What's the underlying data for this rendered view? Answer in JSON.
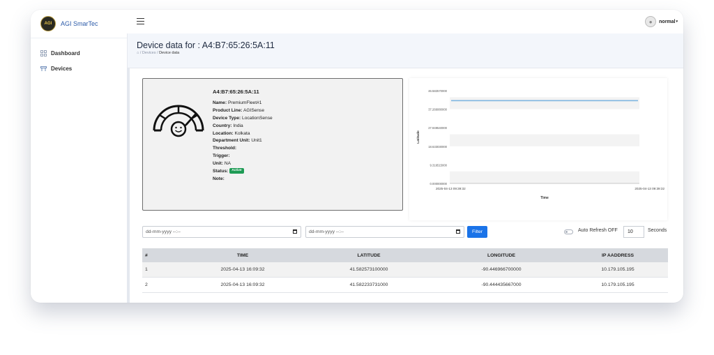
{
  "brand": {
    "name": "AGI SmarTec",
    "logo_text": "AGI"
  },
  "sidebar": {
    "items": [
      {
        "label": "Dashboard",
        "icon": "grid-icon"
      },
      {
        "label": "Devices",
        "icon": "devices-icon"
      }
    ]
  },
  "topbar": {
    "user": "normal"
  },
  "page": {
    "title": "Device data for : A4:B7:65:26:5A:11",
    "breadcrumb": {
      "home": "⌂",
      "sep1": "/",
      "devices": "Devices",
      "sep2": "/",
      "current": "Device data"
    }
  },
  "device": {
    "mac": "A4:B7:65:26:5A:11",
    "fields": [
      {
        "label": "Name:",
        "value": "PremiumFleet#1"
      },
      {
        "label": "Product Line:",
        "value": "AGISense"
      },
      {
        "label": "Device Type:",
        "value": "LocationSense"
      },
      {
        "label": "Country:",
        "value": "India"
      },
      {
        "label": "Location:",
        "value": "Kolkata"
      },
      {
        "label": "Department Unit:",
        "value": "Unit1"
      },
      {
        "label": "Threshold:",
        "value": ""
      },
      {
        "label": "Trigger:",
        "value": ""
      },
      {
        "label": "Unit:",
        "value": "NA"
      }
    ],
    "status_label": "Status:",
    "status": "Active",
    "note_label": "Note:",
    "note": ""
  },
  "chart_data": {
    "type": "line",
    "x": [
      "2025-04-13 09:39:32",
      "2025-04-13 09:39:32"
    ],
    "series": [
      {
        "values": [
          41.582573,
          41.582234
        ],
        "color": "#7fb6e0"
      }
    ],
    "xlabel": "Time",
    "ylabel": "Latitude",
    "yticks": [
      "46.582570000",
      "37.266080000",
      "27.949540000",
      "18.633030000",
      "9.316515000",
      "0.000000000"
    ],
    "ylim": [
      0,
      46.58257
    ],
    "grid": "horizontal bands"
  },
  "filters": {
    "from_placeholder": "dd-mm-yyyy --:--",
    "to_placeholder": "dd-mm-yyyy --:--",
    "filter_label": "Filter",
    "auto_refresh_label": "Auto Refresh OFF",
    "refresh_seconds": "10",
    "seconds_label": "Seconds"
  },
  "table": {
    "headers": [
      "#",
      "TIME",
      "LATITUDE",
      "LONGITUDE",
      "IP AADDRESS"
    ],
    "rows": [
      [
        "1",
        "2025-04-13 16:09:32",
        "41.582573100000",
        "-90.446966700000",
        "10.179.105.195"
      ],
      [
        "2",
        "2025-04-13 16:09:32",
        "41.582233731000",
        "-90.444435667000",
        "10.179.105.195"
      ]
    ]
  }
}
